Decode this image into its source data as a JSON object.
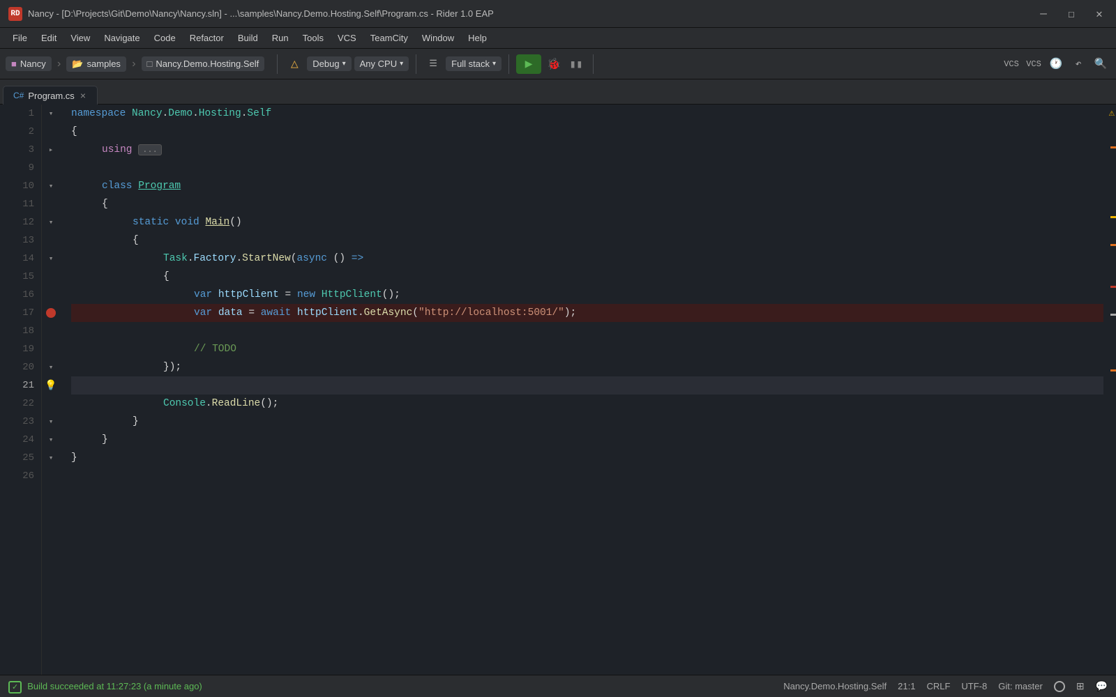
{
  "titleBar": {
    "icon": "RD",
    "title": "Nancy - [D:\\Projects\\Git\\Demo\\Nancy\\Nancy.sln] - ...\\samples\\Nancy.Demo.Hosting.Self\\Program.cs - Rider 1.0 EAP",
    "minimize": "—",
    "maximize": "☐",
    "close": "✕"
  },
  "menuBar": {
    "items": [
      "File",
      "Edit",
      "View",
      "Navigate",
      "Code",
      "Refactor",
      "Build",
      "Run",
      "Tools",
      "VCS",
      "TeamCity",
      "Window",
      "Help"
    ]
  },
  "toolbar": {
    "nancy_label": "Nancy",
    "samples_label": "samples",
    "project_label": "Nancy.Demo.Hosting.Self",
    "debug_label": "Debug",
    "cpu_label": "Any CPU",
    "stack_label": "Full stack"
  },
  "tab": {
    "filename": "Program.cs",
    "close": "×"
  },
  "lineNumbers": [
    1,
    2,
    3,
    9,
    10,
    11,
    12,
    13,
    14,
    15,
    16,
    17,
    18,
    19,
    20,
    21,
    22,
    23,
    24,
    25,
    26
  ],
  "statusBar": {
    "build_status": "Build succeeded at 11:27:23 (a minute ago)",
    "project": "Nancy.Demo.Hosting.Self",
    "position": "21:1",
    "line_endings": "CRLF",
    "encoding": "UTF-8",
    "vcs": "Git: master"
  },
  "code": {
    "lines": [
      {
        "num": 1,
        "content": "namespace_nancy_demo",
        "display": "namespace Nancy.Demo.Hosting.Self"
      },
      {
        "num": 2,
        "content": "open_brace",
        "display": "{"
      },
      {
        "num": 3,
        "content": "using_ellipsis",
        "display": "    using ..."
      },
      {
        "num": 9,
        "content": "empty",
        "display": ""
      },
      {
        "num": 10,
        "content": "class_program",
        "display": "    class Program"
      },
      {
        "num": 11,
        "content": "open_brace2",
        "display": "    {"
      },
      {
        "num": 12,
        "content": "static_void_main",
        "display": "        static void Main()"
      },
      {
        "num": 13,
        "content": "open_brace3",
        "display": "        {"
      },
      {
        "num": 14,
        "content": "task_factory",
        "display": "            Task.Factory.StartNew(async () =>"
      },
      {
        "num": 15,
        "content": "open_brace4",
        "display": "            {"
      },
      {
        "num": 16,
        "content": "var_httpclient",
        "display": "                var httpClient = new HttpClient();"
      },
      {
        "num": 17,
        "content": "var_data",
        "display": "                var data = await httpClient.GetAsync(\"http://localhost:5001/\");"
      },
      {
        "num": 18,
        "content": "empty2",
        "display": ""
      },
      {
        "num": 19,
        "content": "todo_comment",
        "display": "                // TODO"
      },
      {
        "num": 20,
        "content": "close_brace4",
        "display": "            });"
      },
      {
        "num": 21,
        "content": "empty3",
        "display": ""
      },
      {
        "num": 22,
        "content": "console_readline",
        "display": "            Console.ReadLine();"
      },
      {
        "num": 23,
        "content": "close_brace3",
        "display": "        }"
      },
      {
        "num": 24,
        "content": "close_brace2",
        "display": "    }"
      },
      {
        "num": 25,
        "content": "close_brace1",
        "display": "}"
      },
      {
        "num": 26,
        "content": "empty4",
        "display": ""
      }
    ]
  }
}
